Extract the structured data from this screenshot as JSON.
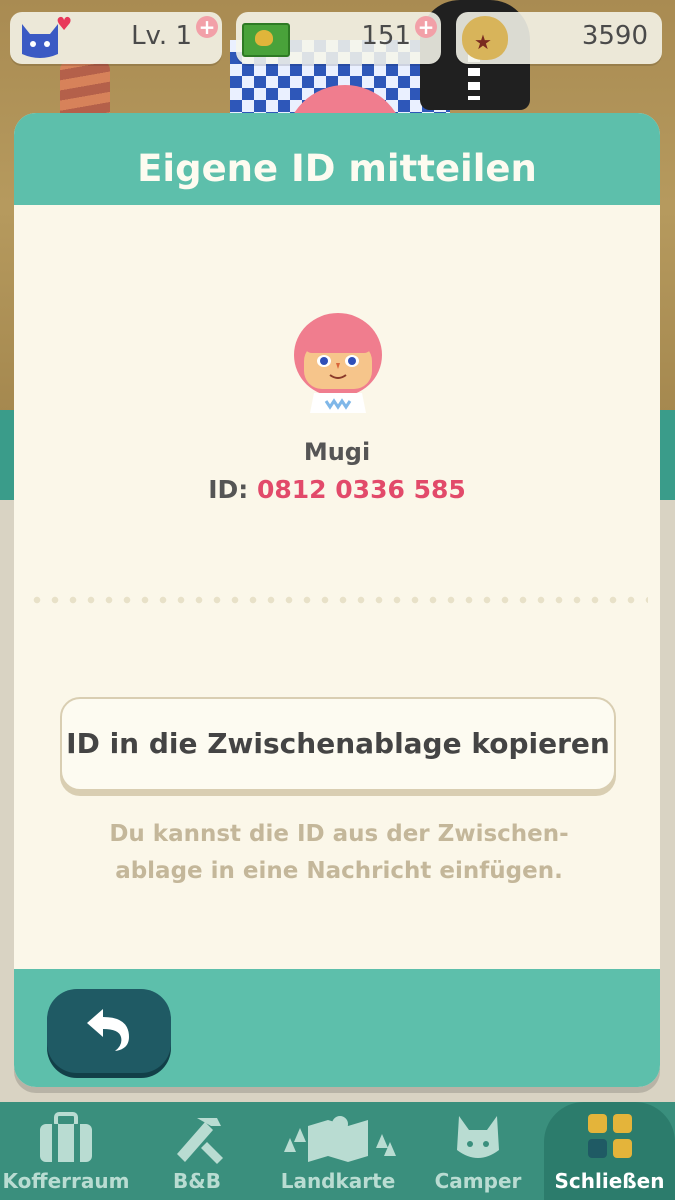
{
  "status_bar": {
    "level": "Lv. 1",
    "tickets": "151",
    "bells": "3590"
  },
  "dialog": {
    "title": "Eigene ID mitteilen",
    "player_name": "Mugi",
    "id_label": "ID:",
    "id_value": "0812 0336 585",
    "copy_button": "ID in die Zwischenablage kopieren",
    "hint_line1": "Du kannst die ID aus der Zwischen-",
    "hint_line2": "ablage in eine Nachricht einfügen."
  },
  "nav": {
    "items": [
      {
        "label": "Kofferraum",
        "icon": "suitcase-icon"
      },
      {
        "label": "B&B",
        "icon": "tools-icon"
      },
      {
        "label": "Landkarte",
        "icon": "map-icon"
      },
      {
        "label": "Camper",
        "icon": "cat-face-icon"
      },
      {
        "label": "Schließen",
        "icon": "grid-icon"
      }
    ],
    "active": "Schließen"
  },
  "colors": {
    "teal": "#5dbfab",
    "dark_teal": "#1f5a64",
    "id_pink": "#e24a6a",
    "cream": "#fbf7e9"
  }
}
